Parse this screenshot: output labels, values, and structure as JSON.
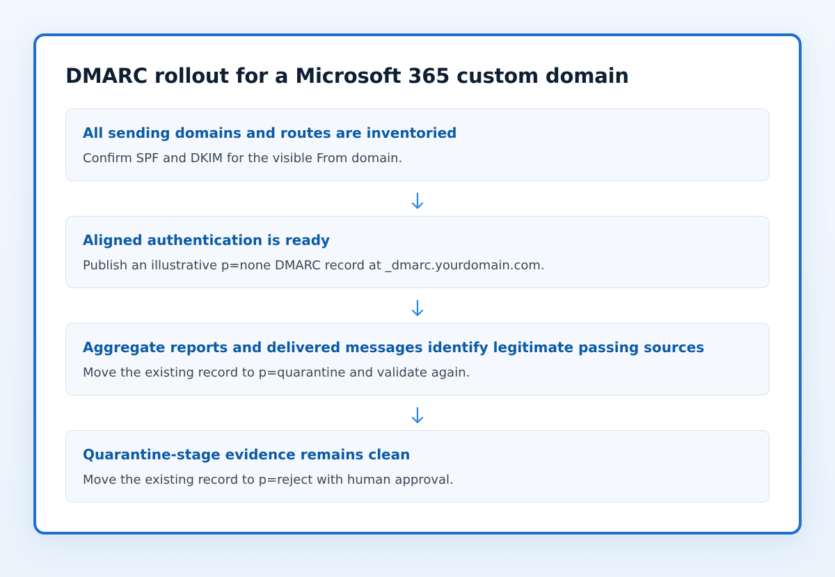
{
  "title": "DMARC rollout for a Microsoft 365 custom domain",
  "steps": [
    {
      "title": "All sending domains and routes are inventoried",
      "description": "Confirm SPF and DKIM for the visible From domain."
    },
    {
      "title": "Aligned authentication is ready",
      "description": "Publish an illustrative p=none DMARC record at _dmarc.yourdomain.com."
    },
    {
      "title": "Aggregate reports and delivered messages identify legitimate passing sources",
      "description": "Move the existing record to p=quarantine and validate again."
    },
    {
      "title": "Quarantine-stage evidence remains clean",
      "description": "Move the existing record to p=reject with human approval."
    }
  ],
  "colors": {
    "frame": "#1e6fd0",
    "step_title": "#0c5aa6",
    "arrow": "#2b86e0"
  },
  "connector_icon": "down-arrow-icon"
}
